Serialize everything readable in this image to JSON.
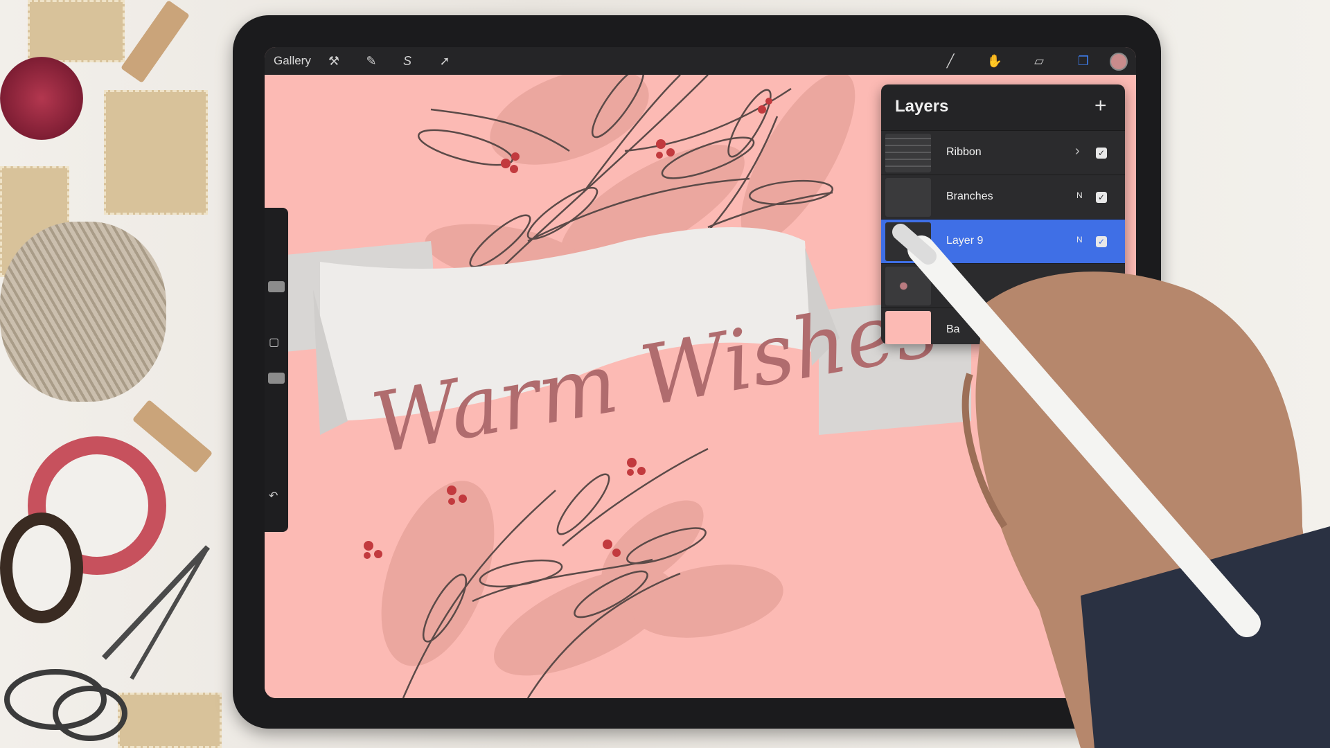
{
  "topbar": {
    "gallery_label": "Gallery",
    "left_tools": [
      {
        "icon": "wrench-icon",
        "glyph": "⚒"
      },
      {
        "icon": "magic-wand-icon",
        "glyph": "✎"
      },
      {
        "icon": "selection-icon",
        "glyph": "S"
      },
      {
        "icon": "transform-arrow-icon",
        "glyph": "➚"
      }
    ],
    "right_tools": [
      {
        "icon": "brush-icon",
        "glyph": "╱"
      },
      {
        "icon": "smudge-icon",
        "glyph": "✋"
      },
      {
        "icon": "eraser-icon",
        "glyph": "▱"
      },
      {
        "icon": "layers-icon",
        "glyph": "❐"
      }
    ],
    "color_swatch": "#c98c8c"
  },
  "artwork": {
    "ribbon_text": "Warm Wishes",
    "background_color": "#fcbab4",
    "leaf_color": "#e8a39b",
    "line_color": "#5b4a48",
    "berry_color": "#c23a3e",
    "ribbon_color": "#eeecea",
    "ribbon_shadow": "#d8d6d4"
  },
  "layers_panel": {
    "title": "Layers",
    "add_glyph": "+",
    "rows": [
      {
        "name": "Ribbon",
        "mode": "",
        "expandable": true,
        "checked": true,
        "selected": false
      },
      {
        "name": "Branches",
        "mode": "N",
        "expandable": false,
        "checked": true,
        "selected": false
      },
      {
        "name": "Layer 9",
        "mode": "N",
        "expandable": false,
        "checked": true,
        "selected": true
      },
      {
        "name": "",
        "mode": "",
        "expandable": false,
        "checked": false,
        "selected": false
      },
      {
        "name": "Ba",
        "mode": "",
        "expandable": false,
        "checked": false,
        "selected": false
      }
    ]
  },
  "sidebar": {
    "square_glyph": "▢",
    "undo_glyph": "↶"
  }
}
